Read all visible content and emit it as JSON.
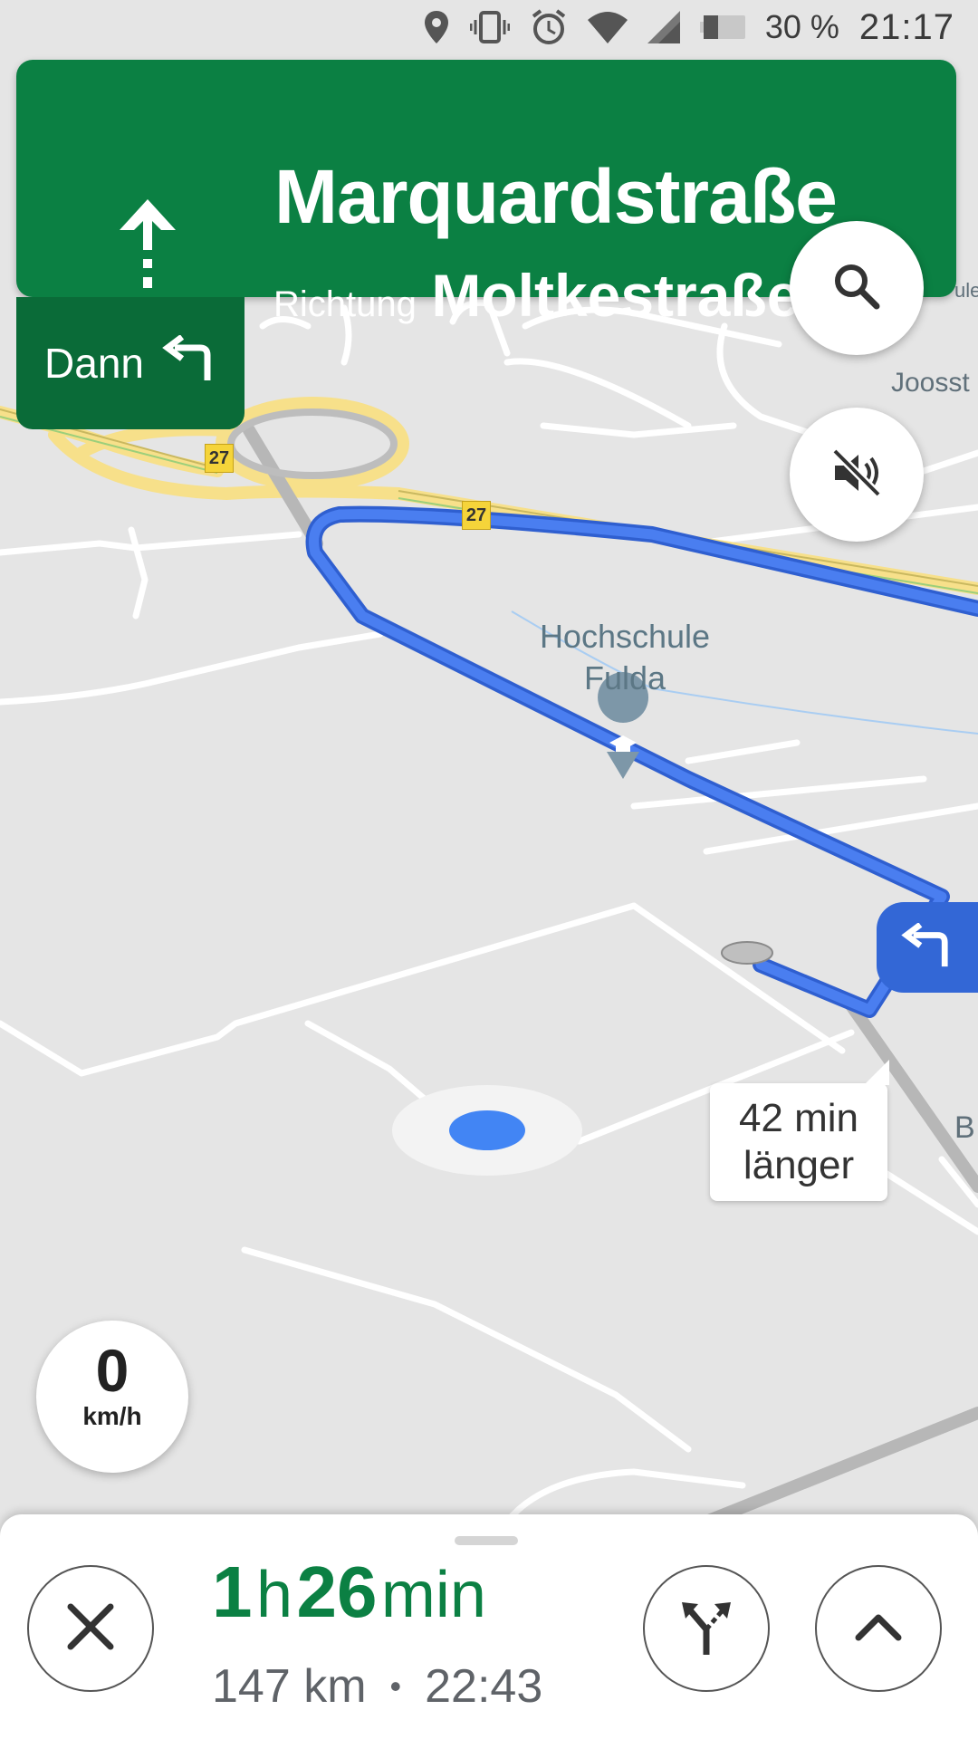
{
  "status_bar": {
    "battery": "30 %",
    "time": "21:17",
    "icons": [
      "location-icon",
      "vibrate-icon",
      "alarm-icon",
      "wifi-icon",
      "signal-icon",
      "battery-icon"
    ]
  },
  "navigation": {
    "maneuver_icon": "straight-arrow-icon",
    "street": "Marquardstraße",
    "toward_prefix": "Richtung",
    "toward": "Moltkestraße",
    "then_label": "Dann",
    "then_icon": "turn-left-icon"
  },
  "map": {
    "poi_name_line1": "Hochschule",
    "poi_name_line2": "Fulda",
    "poi_icon": "graduation-cap-icon",
    "street_labels": {
      "joosstr": "Joosst",
      "b_label": "B",
      "ule": "ule"
    },
    "route_badges": [
      "27",
      "27"
    ],
    "delay_line1": "42 min",
    "delay_line2": "länger",
    "route_color": "#4a7ef0",
    "primary_color": "#0b8043"
  },
  "speed": {
    "value": "0",
    "unit": "km/h"
  },
  "trip": {
    "hours": "1",
    "hours_unit": "h",
    "minutes": "26",
    "minutes_unit": "min",
    "distance": "147 km",
    "separator": "•",
    "arrival": "22:43"
  }
}
